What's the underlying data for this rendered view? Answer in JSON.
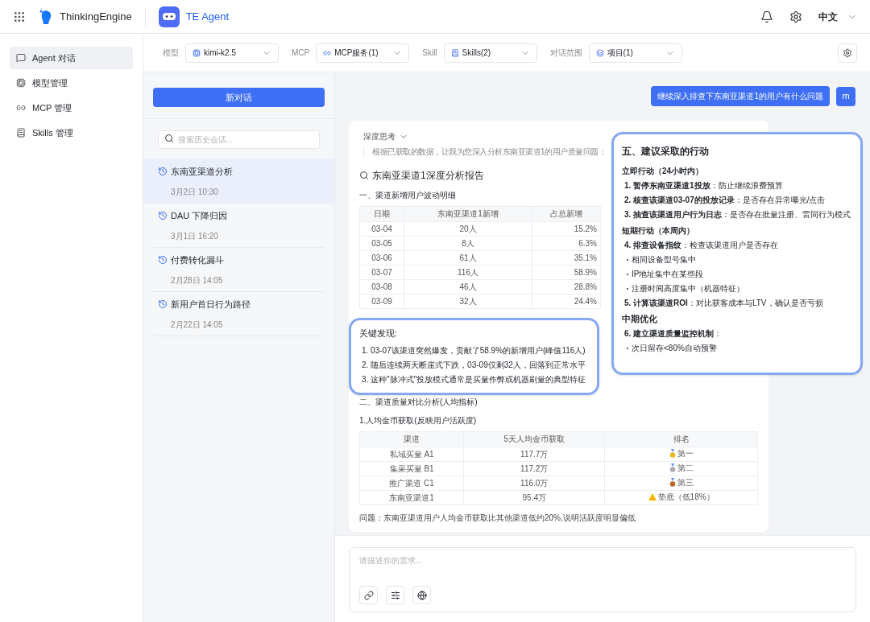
{
  "header": {
    "app_name": "ThinkingEngine",
    "product_name": "TE Agent",
    "language": "中文"
  },
  "sidebar": {
    "items": [
      {
        "label": "Agent 对话",
        "selected": true
      },
      {
        "label": "模型管理",
        "selected": false
      },
      {
        "label": "MCP 管理",
        "selected": false
      },
      {
        "label": "Skills 管理",
        "selected": false
      }
    ]
  },
  "toolbar": {
    "selectors": [
      {
        "label": "模型",
        "value": "kimi-k2.5"
      },
      {
        "label": "MCP",
        "value": "MCP服务(1)"
      },
      {
        "label": "Skill",
        "value": "Skills(2)"
      },
      {
        "label": "对话范围",
        "value": "项目(1)"
      }
    ]
  },
  "history": {
    "new_button": "新对话",
    "search_placeholder": "搜索历史会话...",
    "items": [
      {
        "title": "东南亚渠道分析",
        "time": "3月2日 10:30",
        "selected": true
      },
      {
        "title": "DAU 下降归因",
        "time": "3月1日 16:20",
        "selected": false
      },
      {
        "title": "付费转化漏斗",
        "time": "2月28日 14:05",
        "selected": false
      },
      {
        "title": "新用户首日行为路径",
        "time": "2月22日 14:05",
        "selected": false
      }
    ]
  },
  "chat": {
    "user_message": {
      "text": "继续深入排查下东南亚渠道1的用户有什么问题",
      "avatar": "m"
    },
    "card": {
      "thinking_label": "深度思考",
      "thinking_text": "根据已获取的数据，让我为您深入分析东南亚渠道1的用户质量问题：",
      "title": "东南亚渠道1深度分析报告",
      "section1": "一、渠道新增用户波动明细",
      "table1": {
        "columns": [
          "日期",
          "东南亚渠道1新增",
          "占总新增"
        ],
        "rows": [
          [
            "03-04",
            "20人",
            "15.2%"
          ],
          [
            "03-05",
            "8人",
            "6.3%"
          ],
          [
            "03-06",
            "61人",
            "35.1%"
          ],
          [
            "03-07",
            "116人",
            "58.9%"
          ],
          [
            "03-08",
            "46人",
            "28.8%"
          ],
          [
            "03-09",
            "32人",
            "24.4%"
          ]
        ]
      },
      "section2": "二、渠道质量对比分析(人均指标)",
      "subsection": "1.人均金币获取(反映用户活跃度)",
      "table2": {
        "columns": [
          "渠道",
          "5天人均金币获取",
          "排名"
        ],
        "rows": [
          {
            "channel": "私域买量 A1",
            "value": "117.7万",
            "rank": "第一",
            "kind": "gold"
          },
          {
            "channel": "集采买量 B1",
            "value": "117.2万",
            "rank": "第二",
            "kind": "silver"
          },
          {
            "channel": "推广渠道 C1",
            "value": "116.0万",
            "rank": "第三",
            "kind": "bronze"
          },
          {
            "channel": "东南亚渠道1",
            "value": "95.4万",
            "rank": "垫底（低18%）",
            "kind": "warning"
          }
        ]
      },
      "note": "问题：东南亚渠道用户人均金币获取比其他渠道低约20%,说明活跃度明显偏低"
    }
  },
  "callouts": {
    "findings": {
      "title": "关键发现:",
      "items": [
        "1. 03-07该渠道突然爆发，贡献了58.9%的新增用户(峰值116人)",
        "2. 随后连续两天断崖式下跌，03-09仅剩32人，回落到正常水平",
        "3. 这种\"脉冲式\"投放模式通常是买量作弊或机器刷量的典型特征"
      ]
    },
    "actions": {
      "title": "五、建议采取的行动",
      "lines": [
        {
          "kind": "subheading",
          "text": "立即行动（24小时内）"
        },
        {
          "kind": "numbered",
          "text": "**1. 暂停东南亚渠道1投放**：防止继续浪费预算"
        },
        {
          "kind": "numbered",
          "text": "**2. 核查该渠道03-07的投放记录**：是否存在异常曝光/点击"
        },
        {
          "kind": "numbered",
          "text": "**3. 抽查该渠道用户行为日志**：是否存在批量注册、雷同行为模式"
        },
        {
          "kind": "subheading",
          "text": "短期行动（本周内）"
        },
        {
          "kind": "numbered",
          "text": "**4. 排查设备指纹**：检查该渠道用户是否存在"
        },
        {
          "kind": "bullet",
          "text": "相同设备型号集中"
        },
        {
          "kind": "bullet",
          "text": "IP地址集中在某些段"
        },
        {
          "kind": "bullet",
          "text": "注册时间高度集中（机器特征）"
        },
        {
          "kind": "numbered",
          "text": "**5. 计算该渠道ROI**：对比获客成本与LTV，确认是否亏损"
        },
        {
          "kind": "heading",
          "text": "中期优化"
        },
        {
          "kind": "numbered",
          "text": "**6. 建立渠道质量监控机制**："
        },
        {
          "kind": "bullet",
          "text": "次日留存<80%自动预警"
        }
      ]
    }
  },
  "input": {
    "placeholder": "请描述你的需求..."
  }
}
